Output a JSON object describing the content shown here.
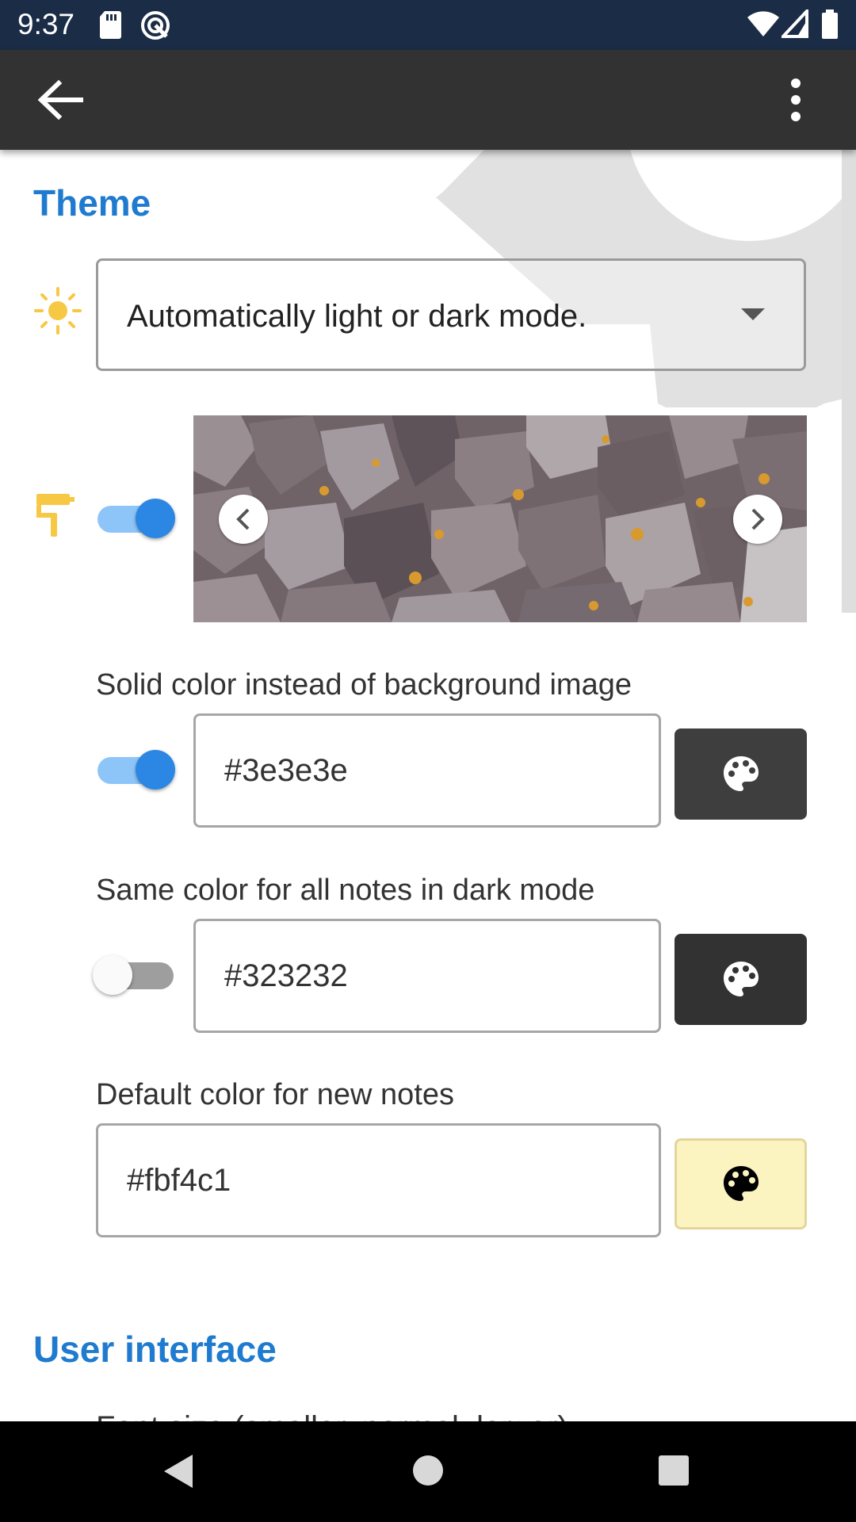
{
  "status_bar": {
    "time": "9:37",
    "icons": [
      "sd-card-icon",
      "circle-badge-icon",
      "wifi-icon",
      "signal-icon",
      "battery-icon"
    ]
  },
  "app_bar": {
    "back_icon": "arrow-back-icon",
    "menu_icon": "more-vert-icon"
  },
  "theme_section": {
    "title": "Theme",
    "mode_icon": "sun-icon",
    "mode_dropdown": {
      "value": "Automatically light or dark mode."
    },
    "background_icon": "paint-roller-icon",
    "background_image_toggle": true,
    "carousel": {
      "prev_icon": "chevron-left-icon",
      "next_icon": "chevron-right-icon"
    },
    "solid_color": {
      "label": "Solid color instead of background image",
      "enabled": true,
      "value": "#3e3e3e",
      "button_color": "#3e3e3e"
    },
    "dark_mode_color": {
      "label": "Same color for all notes in dark mode",
      "enabled": false,
      "value": "#323232",
      "button_color": "#323232"
    },
    "default_note_color": {
      "label": "Default color for new notes",
      "value": "#fbf4c1",
      "button_color": "#fbf4c1"
    }
  },
  "user_interface_section": {
    "title": "User interface",
    "font_size_label": "Font size (smaller, normal, larger)"
  },
  "colors": {
    "accent": "#1f7bcf",
    "switch_on": "#2b87e3",
    "icon_yellow": "#f7c843",
    "app_bar": "#323232",
    "status_bar": "#1b2c46"
  },
  "nav_bar": {
    "icons": [
      "back-triangle-icon",
      "home-circle-icon",
      "recents-square-icon"
    ]
  }
}
